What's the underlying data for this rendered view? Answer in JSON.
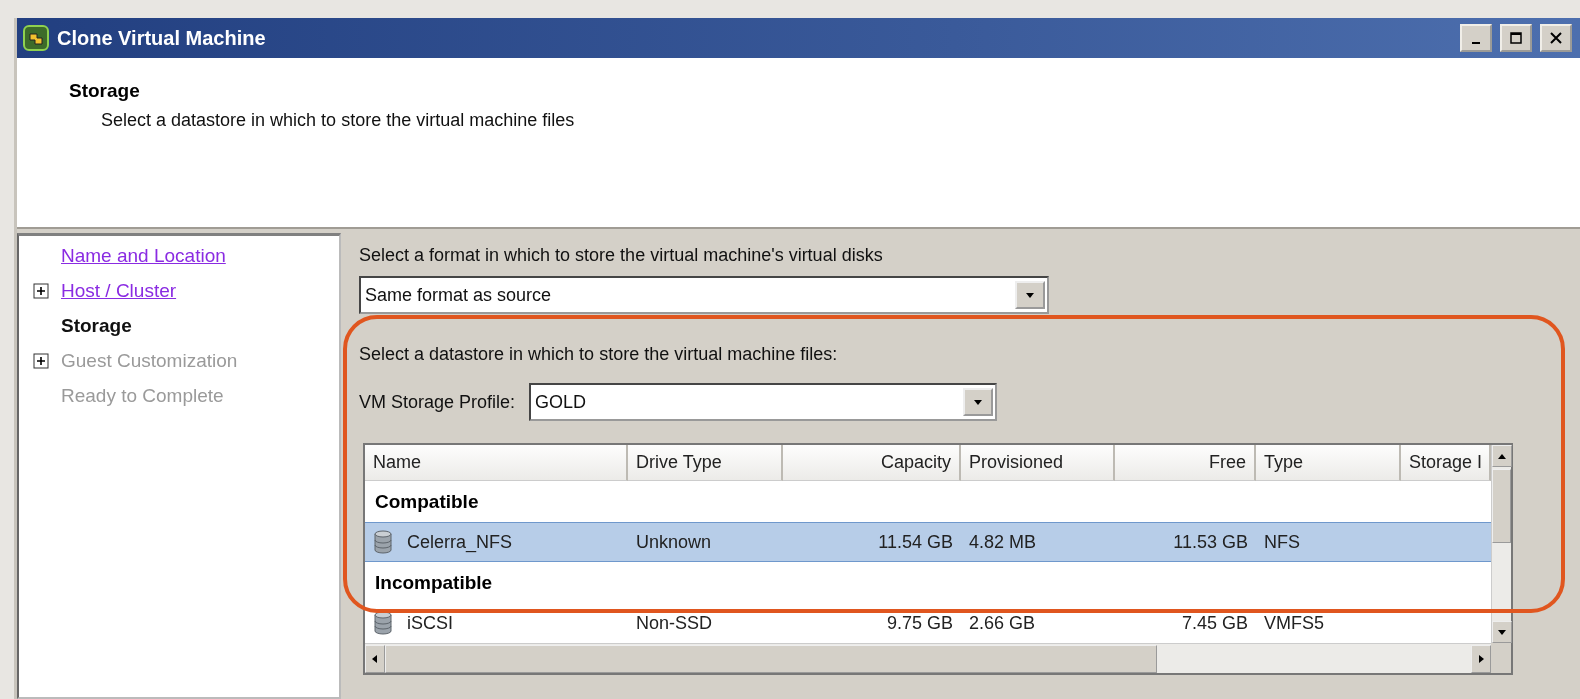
{
  "window": {
    "title": "Clone Virtual Machine"
  },
  "header": {
    "title": "Storage",
    "subtitle": "Select a datastore in which to store the virtual machine files"
  },
  "nav": [
    {
      "label": "Name and Location",
      "visited": true,
      "disabled": false,
      "expandable": false,
      "selected": false
    },
    {
      "label": "Host / Cluster",
      "visited": true,
      "disabled": false,
      "expandable": true,
      "selected": false
    },
    {
      "label": "Storage",
      "visited": false,
      "disabled": false,
      "expandable": false,
      "selected": true
    },
    {
      "label": "Guest Customization",
      "visited": false,
      "disabled": true,
      "expandable": true,
      "selected": false
    },
    {
      "label": "Ready to Complete",
      "visited": false,
      "disabled": true,
      "expandable": false,
      "selected": false
    }
  ],
  "format": {
    "label": "Select a format in which to store the virtual machine's virtual disks",
    "value": "Same format as source"
  },
  "datastore_label": "Select a datastore in which to store the virtual machine files:",
  "profile": {
    "label": "VM Storage Profile:",
    "value": "GOLD"
  },
  "table": {
    "columns": [
      {
        "label": "Name",
        "right_aligned": false
      },
      {
        "label": "Drive Type",
        "right_aligned": false
      },
      {
        "label": "Capacity",
        "right_aligned": true
      },
      {
        "label": "Provisioned",
        "right_aligned": false
      },
      {
        "label": "Free",
        "right_aligned": true
      },
      {
        "label": "Type",
        "right_aligned": false
      },
      {
        "label": "Storage I",
        "right_aligned": false
      }
    ],
    "rows": [
      {
        "kind": "group",
        "label": "Compatible"
      },
      {
        "kind": "datastore",
        "selected": true,
        "cells": [
          "Celerra_NFS",
          "Unknown",
          "11.54 GB",
          "4.82 MB",
          "11.53 GB",
          "NFS"
        ]
      },
      {
        "kind": "group",
        "label": "Incompatible"
      },
      {
        "kind": "datastore",
        "selected": false,
        "cells": [
          "iSCSI",
          "Non-SSD",
          "9.75 GB",
          "2.66 GB",
          "7.45 GB",
          "VMFS5"
        ]
      }
    ]
  },
  "annotation": {
    "visible": true
  }
}
